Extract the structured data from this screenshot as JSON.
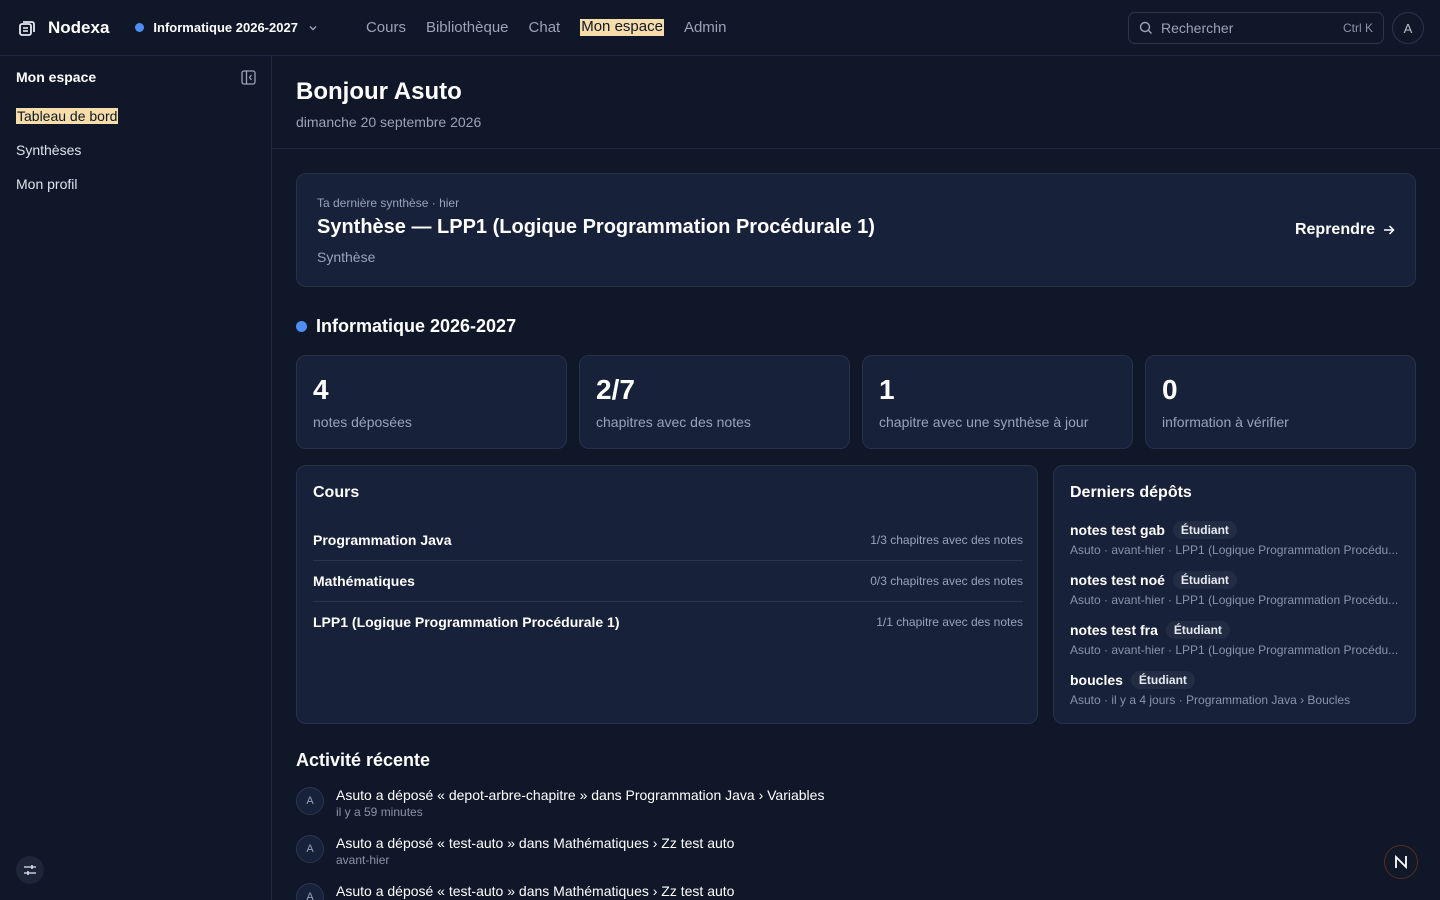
{
  "app": {
    "name": "Nodexa",
    "workspace": "Informatique 2026-2027"
  },
  "nav": {
    "items": [
      {
        "label": "Cours"
      },
      {
        "label": "Bibliothèque"
      },
      {
        "label": "Chat"
      },
      {
        "label": "Mon espace"
      },
      {
        "label": "Admin"
      }
    ]
  },
  "search": {
    "placeholder": "Rechercher",
    "shortcut": "Ctrl K"
  },
  "user": {
    "initial": "A"
  },
  "sidebar": {
    "title": "Mon espace",
    "items": [
      {
        "label": "Tableau de bord"
      },
      {
        "label": "Synthèses"
      },
      {
        "label": "Mon profil"
      }
    ]
  },
  "header": {
    "greeting": "Bonjour Asuto",
    "date": "dimanche 20 septembre 2026"
  },
  "last_synthesis": {
    "kicker": "Ta dernière synthèse · hier",
    "title": "Synthèse — LPP1 (Logique Programmation Procédurale 1)",
    "subtitle": "Synthèse",
    "action": "Reprendre"
  },
  "workspace_section": {
    "title": "Informatique 2026-2027",
    "color": "#4d8ef0"
  },
  "stats": [
    {
      "value": "4",
      "label": "notes déposées"
    },
    {
      "value": "2/7",
      "label": "chapitres avec des notes"
    },
    {
      "value": "1",
      "label": "chapitre avec une synthèse à jour"
    },
    {
      "value": "0",
      "label": "information à vérifier"
    }
  ],
  "courses": {
    "title": "Cours",
    "rows": [
      {
        "name": "Programmation Java",
        "meta": "1/3 chapitres avec des notes"
      },
      {
        "name": "Mathématiques",
        "meta": "0/3 chapitres avec des notes"
      },
      {
        "name": "LPP1 (Logique Programmation Procédurale 1)",
        "meta": "1/1 chapitre avec des notes"
      }
    ]
  },
  "deposits": {
    "title": "Derniers dépôts",
    "items": [
      {
        "name": "notes test gab",
        "badge": "Étudiant",
        "meta": "Asuto · avant-hier · LPP1 (Logique Programmation Procédu..."
      },
      {
        "name": "notes test noé",
        "badge": "Étudiant",
        "meta": "Asuto · avant-hier · LPP1 (Logique Programmation Procédu..."
      },
      {
        "name": "notes test fra",
        "badge": "Étudiant",
        "meta": "Asuto · avant-hier · LPP1 (Logique Programmation Procédu..."
      },
      {
        "name": "boucles",
        "badge": "Étudiant",
        "meta": "Asuto · il y a 4 jours · Programmation Java › Boucles"
      }
    ]
  },
  "activity": {
    "title": "Activité récente",
    "items": [
      {
        "avatar": "A",
        "text": "Asuto a déposé « depot-arbre-chapitre » dans Programmation Java › Variables",
        "time": "il y a 59 minutes"
      },
      {
        "avatar": "A",
        "text": "Asuto a déposé « test-auto » dans Mathématiques › Zz test auto",
        "time": "avant-hier"
      },
      {
        "avatar": "A",
        "text": "Asuto a déposé « test-auto » dans Mathématiques › Zz test auto",
        "time": ""
      }
    ]
  },
  "colors": {
    "background": "#0f1729",
    "card": "#172139",
    "highlight": "#f6ddaa",
    "accent": "#4d8ef0"
  }
}
